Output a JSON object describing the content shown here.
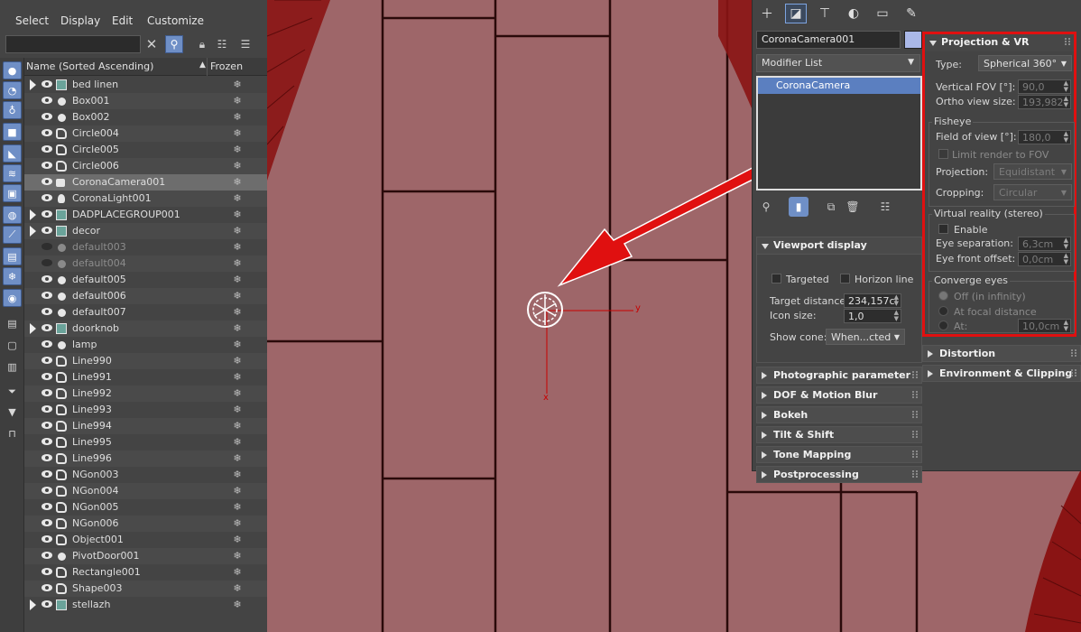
{
  "menu": [
    "Select",
    "Display",
    "Edit",
    "Customize"
  ],
  "list_header": {
    "name": "Name (Sorted Ascending)",
    "frozen": "Frozen"
  },
  "frozen_glyph": "❄",
  "objects": [
    {
      "name": "bed linen",
      "type": "group",
      "expand": true,
      "dim": false
    },
    {
      "name": "Box001",
      "type": "dot",
      "expand": false,
      "dim": false
    },
    {
      "name": "Box002",
      "type": "dot",
      "expand": false,
      "dim": false
    },
    {
      "name": "Circle004",
      "type": "shape",
      "expand": false,
      "dim": false
    },
    {
      "name": "Circle005",
      "type": "shape",
      "expand": false,
      "dim": false
    },
    {
      "name": "Circle006",
      "type": "shape",
      "expand": false,
      "dim": false
    },
    {
      "name": "CoronaCamera001",
      "type": "cam",
      "expand": false,
      "dim": false,
      "selected": true
    },
    {
      "name": "CoronaLight001",
      "type": "light",
      "expand": false,
      "dim": false
    },
    {
      "name": "DADPLACEGROUP001",
      "type": "group",
      "expand": true,
      "dim": false
    },
    {
      "name": "decor",
      "type": "group",
      "expand": true,
      "dim": false
    },
    {
      "name": "default003",
      "type": "dot",
      "expand": false,
      "dim": true
    },
    {
      "name": "default004",
      "type": "dot",
      "expand": false,
      "dim": true
    },
    {
      "name": "default005",
      "type": "dot",
      "expand": false,
      "dim": false
    },
    {
      "name": "default006",
      "type": "dot",
      "expand": false,
      "dim": false
    },
    {
      "name": "default007",
      "type": "dot",
      "expand": false,
      "dim": false
    },
    {
      "name": "doorknob",
      "type": "group",
      "expand": true,
      "dim": false
    },
    {
      "name": "lamp",
      "type": "dot",
      "expand": false,
      "dim": false
    },
    {
      "name": "Line990",
      "type": "shape",
      "expand": false,
      "dim": false
    },
    {
      "name": "Line991",
      "type": "shape",
      "expand": false,
      "dim": false
    },
    {
      "name": "Line992",
      "type": "shape",
      "expand": false,
      "dim": false
    },
    {
      "name": "Line993",
      "type": "shape",
      "expand": false,
      "dim": false
    },
    {
      "name": "Line994",
      "type": "shape",
      "expand": false,
      "dim": false
    },
    {
      "name": "Line995",
      "type": "shape",
      "expand": false,
      "dim": false
    },
    {
      "name": "Line996",
      "type": "shape",
      "expand": false,
      "dim": false
    },
    {
      "name": "NGon003",
      "type": "shape",
      "expand": false,
      "dim": false
    },
    {
      "name": "NGon004",
      "type": "shape",
      "expand": false,
      "dim": false
    },
    {
      "name": "NGon005",
      "type": "shape",
      "expand": false,
      "dim": false
    },
    {
      "name": "NGon006",
      "type": "shape",
      "expand": false,
      "dim": false
    },
    {
      "name": "Object001",
      "type": "shape",
      "expand": false,
      "dim": false
    },
    {
      "name": "PivotDoor001",
      "type": "dot",
      "expand": false,
      "dim": false
    },
    {
      "name": "Rectangle001",
      "type": "shape",
      "expand": false,
      "dim": false
    },
    {
      "name": "Shape003",
      "type": "shape",
      "expand": false,
      "dim": false
    },
    {
      "name": "stellazh",
      "type": "group",
      "expand": true,
      "dim": false
    }
  ],
  "viewport": {
    "axis_y": "y",
    "axis_x": "x"
  },
  "command_panel": {
    "object_name": "CoronaCamera001",
    "object_color": "#aab8e8",
    "modifier_list": "Modifier List",
    "stack_item": "CoronaCamera"
  },
  "viewport_display": {
    "title": "Viewport display",
    "targeted": "Targeted",
    "horizon": "Horizon line",
    "target_distance_label": "Target distance:",
    "target_distance": "234,157cı",
    "icon_size_label": "Icon size:",
    "icon_size": "1,0",
    "show_cone_label": "Show cone:",
    "show_cone": "When...cted"
  },
  "left_rollouts": [
    "Photographic parameter",
    "DOF & Motion Blur",
    "Bokeh",
    "Tilt & Shift",
    "Tone Mapping",
    "Postprocessing"
  ],
  "projection": {
    "title": "Projection & VR",
    "type_label": "Type:",
    "type_value": "Spherical 360°",
    "vfov_label": "Vertical FOV [°]:",
    "vfov": "90,0",
    "ortho_label": "Ortho view size:",
    "ortho": "193,982",
    "fisheye_title": "Fisheye",
    "fov_label": "Field of view [°]:",
    "fov": "180,0",
    "limit_label": "Limit render to FOV",
    "projection_label": "Projection:",
    "projection_value": "Equidistant",
    "cropping_label": "Cropping:",
    "cropping_value": "Circular",
    "vr_title": "Virtual reality (stereo)",
    "enable_label": "Enable",
    "eye_sep_label": "Eye separation:",
    "eye_sep": "6,3cm",
    "eye_front_label": "Eye front offset:",
    "eye_front": "0,0cm",
    "converge_title": "Converge eyes",
    "off_label": "Off (in infinity)",
    "focal_label": "At focal distance",
    "at_label": "At:",
    "at_value": "10,0cm"
  },
  "right_rollouts": [
    "Distortion",
    "Environment & Clipping"
  ],
  "colors": {
    "highlight_red": "#e01010",
    "selection_blue": "#5b7fc0",
    "floor": "#9e6669"
  }
}
